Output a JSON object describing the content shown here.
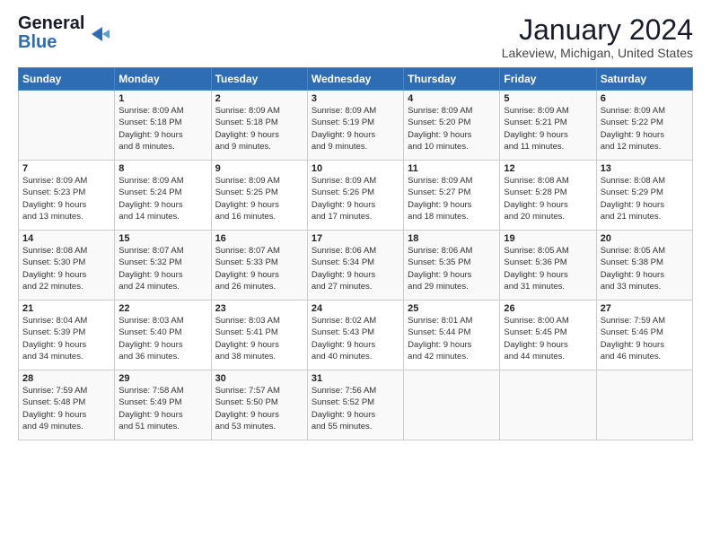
{
  "logo": {
    "line1": "General",
    "line2": "Blue"
  },
  "title": "January 2024",
  "subtitle": "Lakeview, Michigan, United States",
  "days_header": [
    "Sunday",
    "Monday",
    "Tuesday",
    "Wednesday",
    "Thursday",
    "Friday",
    "Saturday"
  ],
  "weeks": [
    [
      {
        "day": "",
        "info": ""
      },
      {
        "day": "1",
        "info": "Sunrise: 8:09 AM\nSunset: 5:18 PM\nDaylight: 9 hours\nand 8 minutes."
      },
      {
        "day": "2",
        "info": "Sunrise: 8:09 AM\nSunset: 5:18 PM\nDaylight: 9 hours\nand 9 minutes."
      },
      {
        "day": "3",
        "info": "Sunrise: 8:09 AM\nSunset: 5:19 PM\nDaylight: 9 hours\nand 9 minutes."
      },
      {
        "day": "4",
        "info": "Sunrise: 8:09 AM\nSunset: 5:20 PM\nDaylight: 9 hours\nand 10 minutes."
      },
      {
        "day": "5",
        "info": "Sunrise: 8:09 AM\nSunset: 5:21 PM\nDaylight: 9 hours\nand 11 minutes."
      },
      {
        "day": "6",
        "info": "Sunrise: 8:09 AM\nSunset: 5:22 PM\nDaylight: 9 hours\nand 12 minutes."
      }
    ],
    [
      {
        "day": "7",
        "info": "Sunrise: 8:09 AM\nSunset: 5:23 PM\nDaylight: 9 hours\nand 13 minutes."
      },
      {
        "day": "8",
        "info": "Sunrise: 8:09 AM\nSunset: 5:24 PM\nDaylight: 9 hours\nand 14 minutes."
      },
      {
        "day": "9",
        "info": "Sunrise: 8:09 AM\nSunset: 5:25 PM\nDaylight: 9 hours\nand 16 minutes."
      },
      {
        "day": "10",
        "info": "Sunrise: 8:09 AM\nSunset: 5:26 PM\nDaylight: 9 hours\nand 17 minutes."
      },
      {
        "day": "11",
        "info": "Sunrise: 8:09 AM\nSunset: 5:27 PM\nDaylight: 9 hours\nand 18 minutes."
      },
      {
        "day": "12",
        "info": "Sunrise: 8:08 AM\nSunset: 5:28 PM\nDaylight: 9 hours\nand 20 minutes."
      },
      {
        "day": "13",
        "info": "Sunrise: 8:08 AM\nSunset: 5:29 PM\nDaylight: 9 hours\nand 21 minutes."
      }
    ],
    [
      {
        "day": "14",
        "info": "Sunrise: 8:08 AM\nSunset: 5:30 PM\nDaylight: 9 hours\nand 22 minutes."
      },
      {
        "day": "15",
        "info": "Sunrise: 8:07 AM\nSunset: 5:32 PM\nDaylight: 9 hours\nand 24 minutes."
      },
      {
        "day": "16",
        "info": "Sunrise: 8:07 AM\nSunset: 5:33 PM\nDaylight: 9 hours\nand 26 minutes."
      },
      {
        "day": "17",
        "info": "Sunrise: 8:06 AM\nSunset: 5:34 PM\nDaylight: 9 hours\nand 27 minutes."
      },
      {
        "day": "18",
        "info": "Sunrise: 8:06 AM\nSunset: 5:35 PM\nDaylight: 9 hours\nand 29 minutes."
      },
      {
        "day": "19",
        "info": "Sunrise: 8:05 AM\nSunset: 5:36 PM\nDaylight: 9 hours\nand 31 minutes."
      },
      {
        "day": "20",
        "info": "Sunrise: 8:05 AM\nSunset: 5:38 PM\nDaylight: 9 hours\nand 33 minutes."
      }
    ],
    [
      {
        "day": "21",
        "info": "Sunrise: 8:04 AM\nSunset: 5:39 PM\nDaylight: 9 hours\nand 34 minutes."
      },
      {
        "day": "22",
        "info": "Sunrise: 8:03 AM\nSunset: 5:40 PM\nDaylight: 9 hours\nand 36 minutes."
      },
      {
        "day": "23",
        "info": "Sunrise: 8:03 AM\nSunset: 5:41 PM\nDaylight: 9 hours\nand 38 minutes."
      },
      {
        "day": "24",
        "info": "Sunrise: 8:02 AM\nSunset: 5:43 PM\nDaylight: 9 hours\nand 40 minutes."
      },
      {
        "day": "25",
        "info": "Sunrise: 8:01 AM\nSunset: 5:44 PM\nDaylight: 9 hours\nand 42 minutes."
      },
      {
        "day": "26",
        "info": "Sunrise: 8:00 AM\nSunset: 5:45 PM\nDaylight: 9 hours\nand 44 minutes."
      },
      {
        "day": "27",
        "info": "Sunrise: 7:59 AM\nSunset: 5:46 PM\nDaylight: 9 hours\nand 46 minutes."
      }
    ],
    [
      {
        "day": "28",
        "info": "Sunrise: 7:59 AM\nSunset: 5:48 PM\nDaylight: 9 hours\nand 49 minutes."
      },
      {
        "day": "29",
        "info": "Sunrise: 7:58 AM\nSunset: 5:49 PM\nDaylight: 9 hours\nand 51 minutes."
      },
      {
        "day": "30",
        "info": "Sunrise: 7:57 AM\nSunset: 5:50 PM\nDaylight: 9 hours\nand 53 minutes."
      },
      {
        "day": "31",
        "info": "Sunrise: 7:56 AM\nSunset: 5:52 PM\nDaylight: 9 hours\nand 55 minutes."
      },
      {
        "day": "",
        "info": ""
      },
      {
        "day": "",
        "info": ""
      },
      {
        "day": "",
        "info": ""
      }
    ]
  ]
}
